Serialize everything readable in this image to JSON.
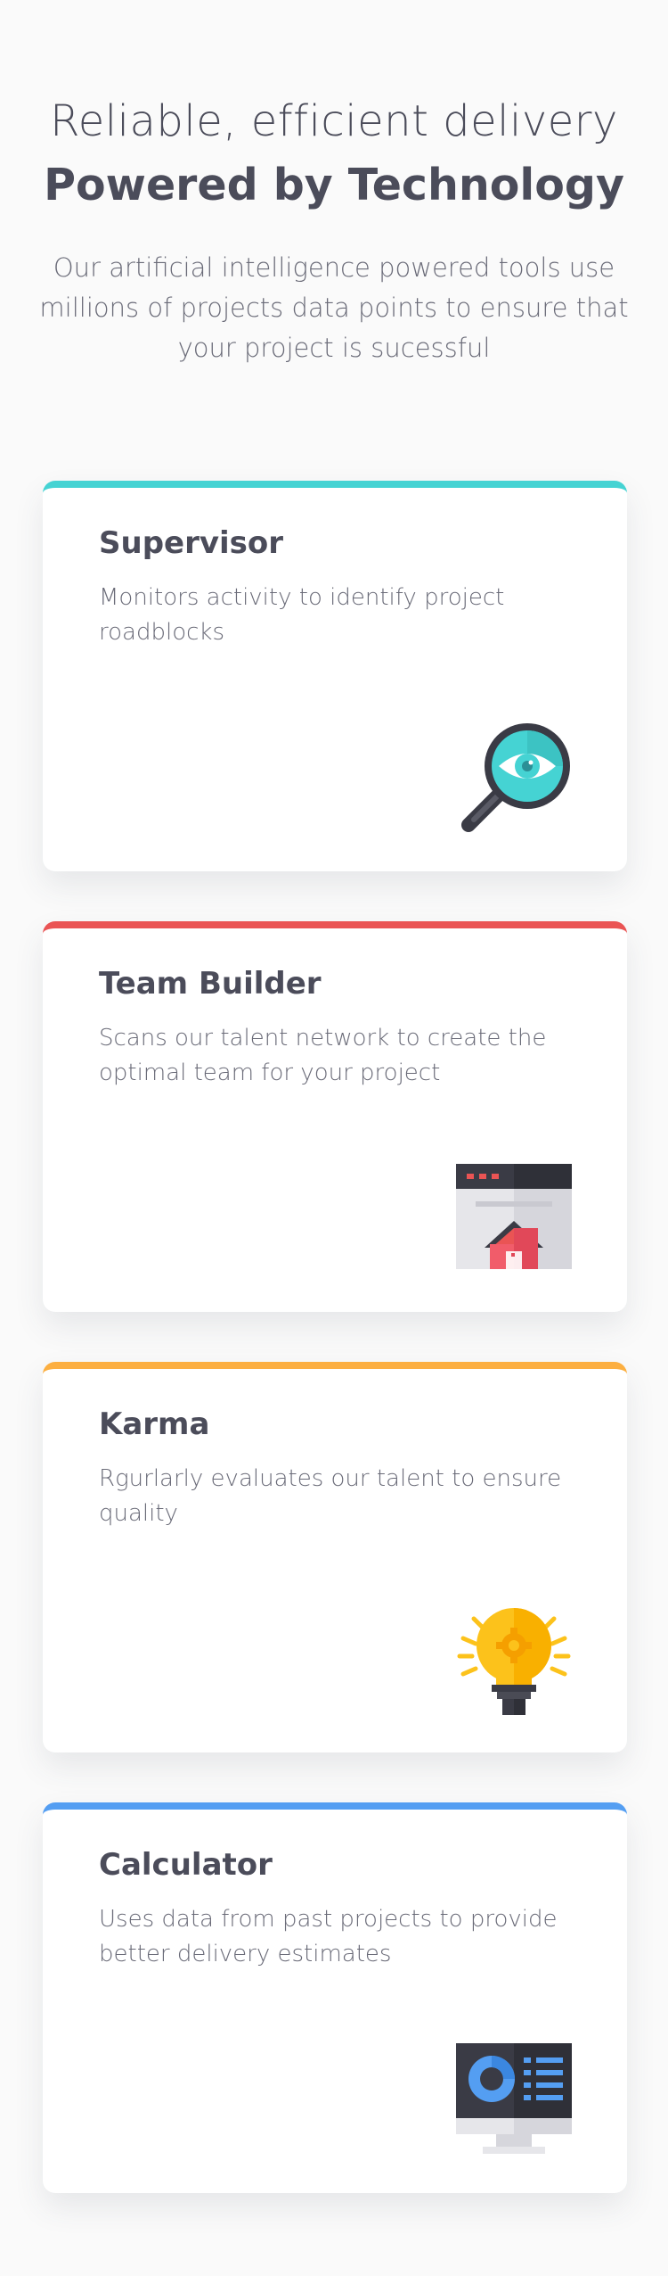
{
  "header": {
    "kicker": "Reliable, efficient delivery",
    "title": "Powered by Technology",
    "lead": "Our artificial intelligence powered tools use millions of projects data points to ensure that your project is sucessful"
  },
  "cards": [
    {
      "title": "Supervisor",
      "description": "Monitors activity to identify project roadblocks",
      "icon": "magnifier-eye-icon",
      "accent": "#45d3d3"
    },
    {
      "title": "Team Builder",
      "description": "Scans our talent network to create the optimal team for your project",
      "icon": "browser-house-icon",
      "accent": "#ea5454"
    },
    {
      "title": "Karma",
      "description": "Rgurlarly evaluates our talent to ensure quality",
      "icon": "lightbulb-icon",
      "accent": "#fcaf41"
    },
    {
      "title": "Calculator",
      "description": "Uses data from past projects to provide better delivery estimates",
      "icon": "monitor-chart-icon",
      "accent": "#549ef2"
    }
  ]
}
